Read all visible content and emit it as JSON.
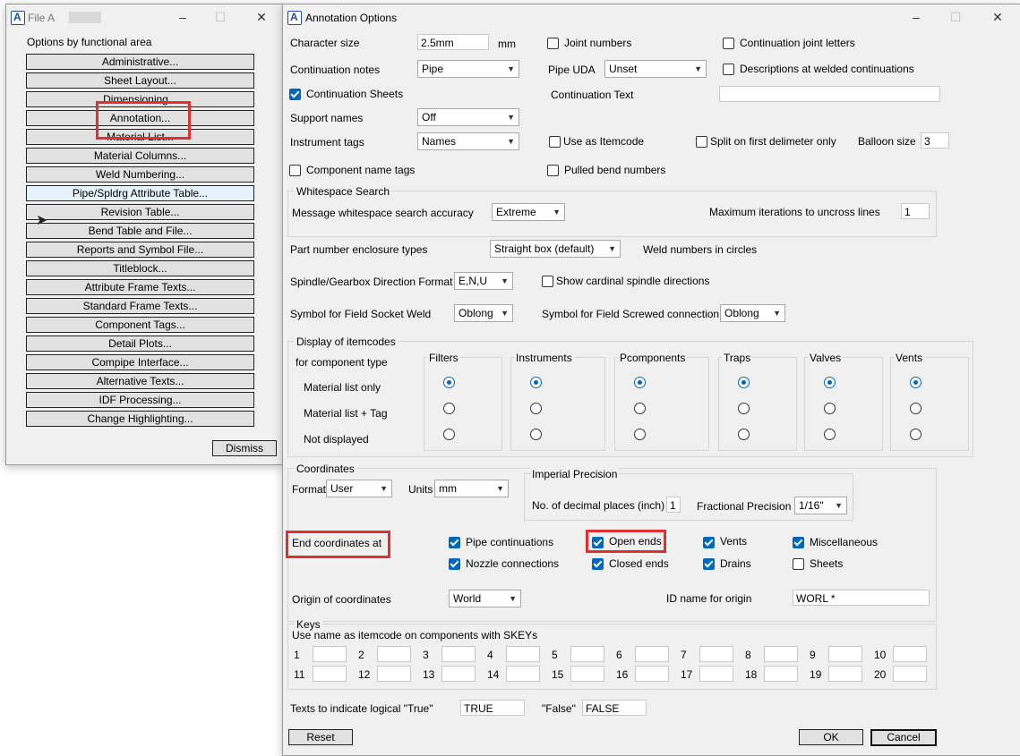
{
  "left_window": {
    "title": "File A",
    "heading": "Options by functional area",
    "buttons": [
      "Administrative...",
      "Sheet Layout...",
      "Dimensioning...",
      "Annotation...",
      "Material List...",
      "Material Columns...",
      "Weld Numbering...",
      "Pipe/Spldrg Attribute Table...",
      "Revision Table...",
      "Bend Table and File...",
      "Reports and Symbol File...",
      "Titleblock...",
      "Attribute Frame Texts...",
      "Standard Frame Texts...",
      "Component Tags...",
      "Detail Plots...",
      "Compipe Interface...",
      "Alternative Texts...",
      "IDF Processing...",
      "Change Highlighting..."
    ],
    "dismiss": "Dismiss"
  },
  "dialog": {
    "title": "Annotation Options",
    "char_size_label": "Character size",
    "char_size_value": "2.5mm",
    "char_size_unit": "mm",
    "joint_numbers": "Joint numbers",
    "cont_joint_letters": "Continuation joint letters",
    "cont_notes_label": "Continuation notes",
    "cont_notes_value": "Pipe",
    "pipe_uda_label": "Pipe UDA",
    "pipe_uda_value": "Unset",
    "desc_welded": "Descriptions at welded continuations",
    "cont_sheets": "Continuation Sheets",
    "cont_text_label": "Continuation Text",
    "support_names_label": "Support names",
    "support_names_value": "Off",
    "instr_tags_label": "Instrument tags",
    "instr_tags_value": "Names",
    "use_as_itemcode": "Use as Itemcode",
    "split_first": "Split on first delimeter only",
    "balloon_label": "Balloon size",
    "balloon_value": "3",
    "comp_name_tags": "Component name tags",
    "pulled_bend": "Pulled bend numbers",
    "whitespace": {
      "title": "Whitespace Search",
      "accuracy_label": "Message whitespace search accuracy",
      "accuracy_value": "Extreme",
      "max_iter_label": "Maximum iterations to uncross lines",
      "max_iter_value": "1"
    },
    "part_enclosure_label": "Part number enclosure types",
    "part_enclosure_value": "Straight box (default)",
    "weld_circles": "Weld numbers in circles",
    "spindle_label": "Spindle/Gearbox Direction Format",
    "spindle_value": "E,N,U",
    "show_cardinal": "Show cardinal spindle directions",
    "socket_weld_label": "Symbol for Field Socket Weld",
    "socket_weld_value": "Oblong",
    "screwed_label": "Symbol for Field Screwed connection",
    "screwed_value": "Oblong",
    "itemcodes": {
      "title": "Display of itemcodes",
      "for_comp": "for component type",
      "rows": [
        "Material list only",
        "Material list + Tag",
        "Not displayed"
      ],
      "columns": [
        "Filters",
        "Instruments",
        "Pcomponents",
        "Traps",
        "Valves",
        "Vents"
      ]
    },
    "coords": {
      "title": "Coordinates",
      "format_label": "Format",
      "format_value": "User",
      "units_label": "Units",
      "units_value": "mm",
      "imperial_title": "Imperial Precision",
      "decimal_label": "No. of decimal places (inch)",
      "decimal_value": "1",
      "fractional_label": "Fractional Precision",
      "fractional_value": "1/16\"",
      "end_coords_label": "End coordinates at",
      "pipe_continuations": "Pipe continuations",
      "open_ends": "Open ends",
      "vents": "Vents",
      "miscellaneous": "Miscellaneous",
      "nozzle_connections": "Nozzle connections",
      "closed_ends": "Closed ends",
      "drains": "Drains",
      "sheets": "Sheets",
      "origin_label": "Origin of coordinates",
      "origin_value": "World",
      "id_name_label": "ID name for origin",
      "id_name_value": "WORL *"
    },
    "keys": {
      "title": "Keys",
      "desc": "Use name as itemcode on components with SKEYs",
      "numbers": [
        "1",
        "2",
        "3",
        "4",
        "5",
        "6",
        "7",
        "8",
        "9",
        "10",
        "11",
        "12",
        "13",
        "14",
        "15",
        "16",
        "17",
        "18",
        "19",
        "20"
      ]
    },
    "true_label": "Texts to indicate logical \"True\"",
    "true_value": "TRUE",
    "false_label": "\"False\"",
    "false_value": "FALSE",
    "reset": "Reset",
    "ok": "OK",
    "cancel": "Cancel"
  },
  "colors": {
    "accent": "#0067c0",
    "highlight": "#e03030"
  }
}
